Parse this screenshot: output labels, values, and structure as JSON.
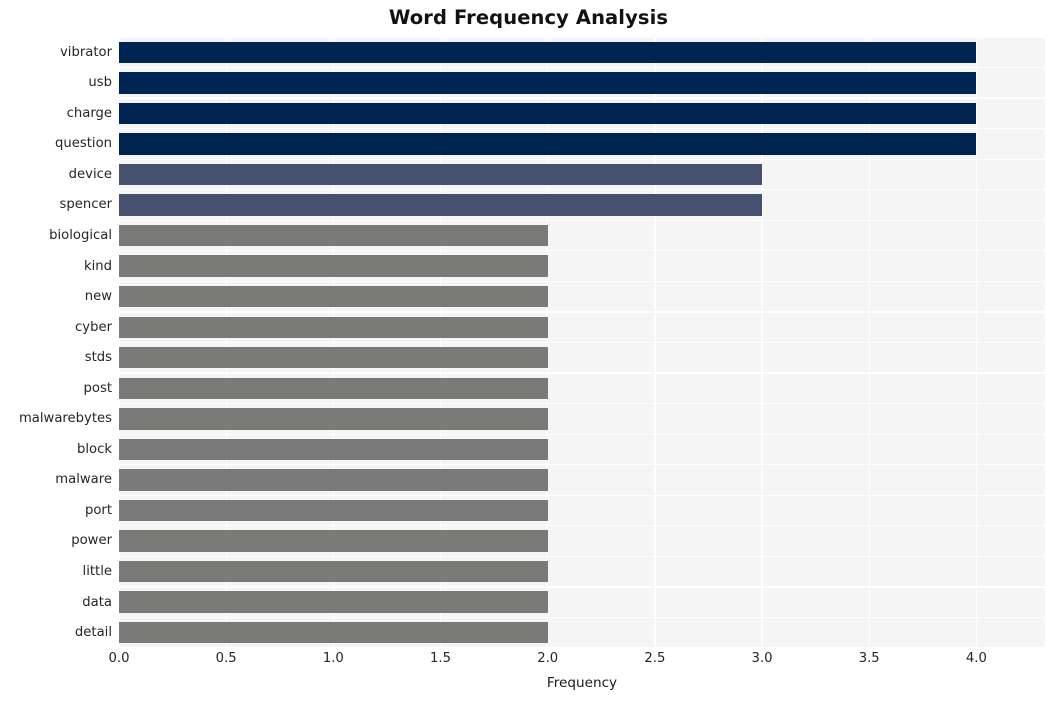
{
  "chart_data": {
    "type": "bar",
    "orientation": "horizontal",
    "title": "Word Frequency Analysis",
    "xlabel": "Frequency",
    "ylabel": "",
    "categories": [
      "vibrator",
      "usb",
      "charge",
      "question",
      "device",
      "spencer",
      "biological",
      "kind",
      "new",
      "cyber",
      "stds",
      "post",
      "malwarebytes",
      "block",
      "malware",
      "port",
      "power",
      "little",
      "data",
      "detail"
    ],
    "values": [
      4,
      4,
      4,
      4,
      3,
      3,
      2,
      2,
      2,
      2,
      2,
      2,
      2,
      2,
      2,
      2,
      2,
      2,
      2,
      2
    ],
    "bar_colors": [
      "#002452",
      "#002452",
      "#002452",
      "#002452",
      "#46506f",
      "#46506f",
      "#7a7a78",
      "#7a7a78",
      "#7a7a78",
      "#7a7a78",
      "#7a7a78",
      "#7a7a78",
      "#7a7a78",
      "#7a7a78",
      "#7a7a78",
      "#7a7a78",
      "#7a7a78",
      "#7a7a78",
      "#7a7a78",
      "#7a7a78"
    ],
    "xlim": [
      0,
      4.32
    ],
    "xticks": [
      0,
      0.5,
      1,
      1.5,
      2,
      2.5,
      3,
      3.5,
      4
    ],
    "xtick_labels": [
      "0.0",
      "0.5",
      "1.0",
      "1.5",
      "2.0",
      "2.5",
      "3.0",
      "3.5",
      "4.0"
    ],
    "grid": true,
    "grid_color": "#ffffff",
    "plot_background": "#f5f5f5",
    "figure_background": "#ffffff",
    "legend": null
  }
}
